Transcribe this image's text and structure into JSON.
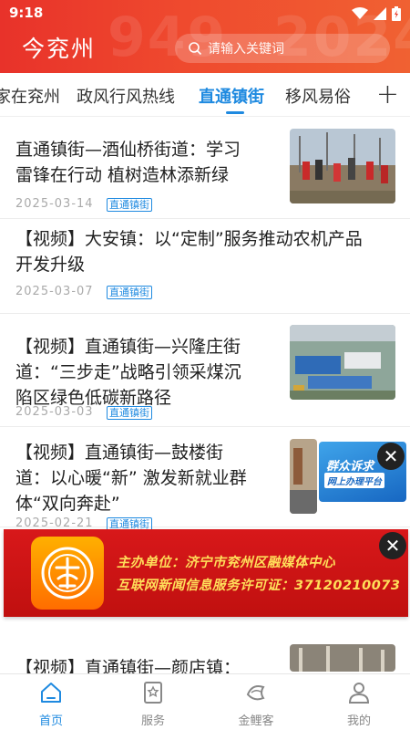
{
  "status_bar": {
    "time": "9:18"
  },
  "header": {
    "title": "今兖州",
    "deco_left": "949",
    "deco_right": "2024",
    "search_placeholder": "请输入关键词"
  },
  "tabs": [
    {
      "label": "家在兖州",
      "active": false
    },
    {
      "label": "政风行风热线",
      "active": false
    },
    {
      "label": "直通镇街",
      "active": true
    },
    {
      "label": "移风易俗",
      "active": false
    }
  ],
  "tab_add_label": "+",
  "articles": [
    {
      "title_lines": [
        "直通镇街—酒仙桥街道：学习",
        "雷锋在行动 植树造林添新绿"
      ],
      "date": "2025-03-14",
      "tag": "直通镇街",
      "has_image": true,
      "image": "people planting trees"
    },
    {
      "title_lines": [
        "【视频】大安镇：以“定制”服务推动农机产品",
        "开发升级"
      ],
      "date": "2025-03-07",
      "tag": "直通镇街",
      "has_image": false
    },
    {
      "title_lines": [
        "【视频】直通镇街—兴隆庄街",
        "道：“三步走”战略引领采煤沉",
        "陷区绿色低碳新路径"
      ],
      "date": "2025-03-03",
      "tag": "直通镇街",
      "has_image": true,
      "image": "aerial view of factory"
    },
    {
      "title_lines": [
        "【视频】直通镇街—鼓楼街",
        "道：以心暖“新” 激发新就业群",
        "体“双向奔赴”"
      ],
      "date": "2025-02-21",
      "tag": "直通镇街",
      "has_image": true,
      "image": "street scene"
    },
    {
      "title_lines": [
        "【视频】直通镇街—颜店镇："
      ],
      "date": "",
      "tag": "",
      "has_image": true,
      "image": "indoor hall"
    }
  ],
  "float_ad": {
    "line1": "群众诉求",
    "line2": "网上办理平台"
  },
  "banner": {
    "line1": "主办单位：济宁市兖州区融媒体中心",
    "line2": "互联网新闻信息服务许可证：37120210073"
  },
  "bottom_nav": [
    {
      "label": "首页",
      "icon": "home-icon",
      "active": true
    },
    {
      "label": "服务",
      "icon": "service-icon",
      "active": false
    },
    {
      "label": "金鲤客",
      "icon": "koi-icon",
      "active": false
    },
    {
      "label": "我的",
      "icon": "user-icon",
      "active": false
    }
  ],
  "colors": {
    "header_red": "#e8322a",
    "accent_blue": "#1f8ae0",
    "banner_red": "#d8181a",
    "banner_text": "#ffde5a"
  }
}
